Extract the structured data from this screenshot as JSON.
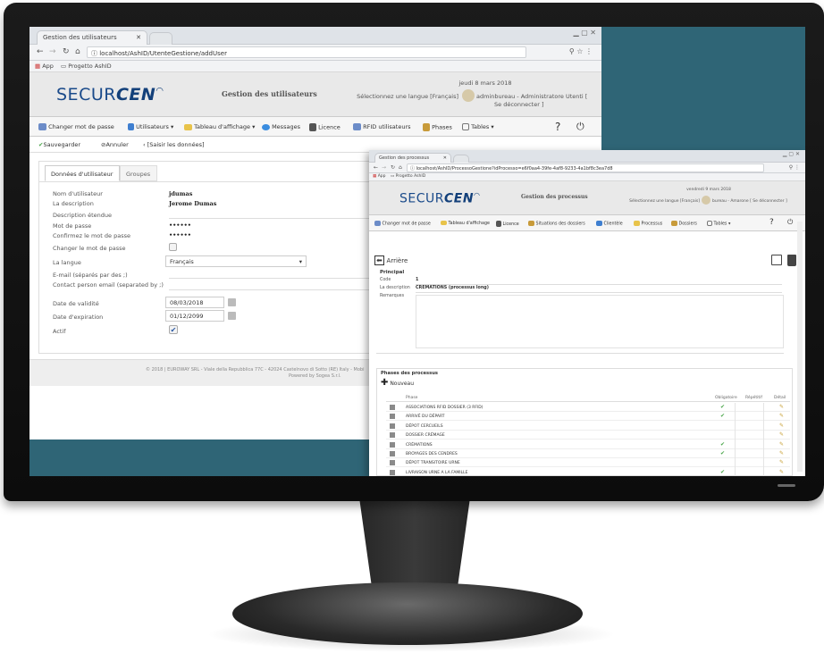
{
  "win1": {
    "tab_title": "Gestion des utilisateurs",
    "url": "localhost/AshID/UtenteGestione/addUser",
    "bookmarks": {
      "apps": "App",
      "item": "Progetto AshID"
    },
    "app": {
      "logo_a": "SECUR",
      "logo_b": "CEN",
      "title": "Gestion des utilisateurs",
      "date": "jeudi 8 mars 2018",
      "lang_line": "Sélectionnez une langue [Français]",
      "user_line": "adminbureau - Administratore Utenti [",
      "logout": "Se déconnecter ]"
    },
    "menu": [
      "Changer mot de passe",
      "Utilisateurs ▾",
      "Tableau d'affichage ▾",
      "Messages",
      "Licence",
      "RFID utilisateurs",
      "Phases",
      "Tables ▾"
    ],
    "help": "?",
    "actions": {
      "save": "Sauvegarder",
      "cancel": "Annuler",
      "enter": "[Saisir les données]"
    },
    "tabs": [
      "Données d'utilisateur",
      "Groupes"
    ],
    "form": {
      "username_label": "Nom d'utilisateur",
      "username": "jdumas",
      "desc_label": "La description",
      "desc": "Jerome Dumas",
      "desc_ext_label": "Description étendue",
      "pwd_label": "Mot de passe",
      "pwd": "••••••",
      "pwd2_label": "Confirmez le mot de passe",
      "pwd2": "••••••",
      "change_pwd_label": "Changer le mot de passe",
      "lang_label": "La langue",
      "lang": "Français",
      "email_label": "E-mail (séparés par des ;)",
      "contact_label": "Contact person email (separated by ;)",
      "valid_label": "Date de validité",
      "valid": "08/03/2018",
      "expire_label": "Date d'expiration",
      "expire": "01/12/2099",
      "active_label": "Actif"
    },
    "footer": "© 2018 | EUROWAY SRL - Viale della Repubblica 77C - 42024 Castelnovo di Sotto (RE) Italy - Mobi",
    "footer2": "Powered by Sogea S.r.l."
  },
  "win2": {
    "tab_title": "Gestion des processus",
    "url": "localhost/AshID/ProcessoGestione?idProcesso=e6f0aa4-39fe-4af8-9233-4a1bf8c3ea7d8",
    "bookmarks": {
      "apps": "App",
      "item": "Progetto AshID"
    },
    "app": {
      "logo_a": "SECUR",
      "logo_b": "CEN",
      "title": "Gestion des processus",
      "date": "vendredi 9 mars 2018",
      "lang_line": "Sélectionnez une langue [Français]",
      "user_line": "bureau - Amarone [ Se déconnecter ]"
    },
    "menu": [
      "Changer mot de passe",
      "Tableau d'affichage",
      "Licence",
      "Situations des dossiers",
      "Clientèle",
      "Processus",
      "Dossiers",
      "Tables ▾"
    ],
    "help": "?",
    "back": "Arrière",
    "section": "Principal",
    "code_label": "Code",
    "code": "1",
    "desc_label": "La description",
    "desc": "CREMATIONS (processus long)",
    "remarks_label": "Remarques",
    "phases_title": "Phases des processus",
    "new_label": "Nouveau",
    "table_headers": [
      "Phase",
      "Obligatoire",
      "Répétitif",
      "Détail"
    ],
    "rows": [
      {
        "phase": "ASSOCIATIONS RFID DOSSIER (3 RFID)",
        "mandatory": "✔"
      },
      {
        "phase": "ARRIVÉ DU DÉPART",
        "mandatory": "✔"
      },
      {
        "phase": "DÉPOT CERCUEILS",
        "mandatory": ""
      },
      {
        "phase": "DOSSIER CRÉMAGE",
        "mandatory": ""
      },
      {
        "phase": "CRÉMATIONS",
        "mandatory": "✔"
      },
      {
        "phase": "BROYAGES DES CENDRES",
        "mandatory": "✔"
      },
      {
        "phase": "DÉPOT TRANSITOIRE URNE",
        "mandatory": ""
      },
      {
        "phase": "LIVRAISON URNE A LA FAMILLE",
        "mandatory": "✔"
      }
    ]
  },
  "colors": {
    "screen_bg": "#2f6576",
    "logo": "#1a4a8a",
    "check": "#4aa64a"
  }
}
